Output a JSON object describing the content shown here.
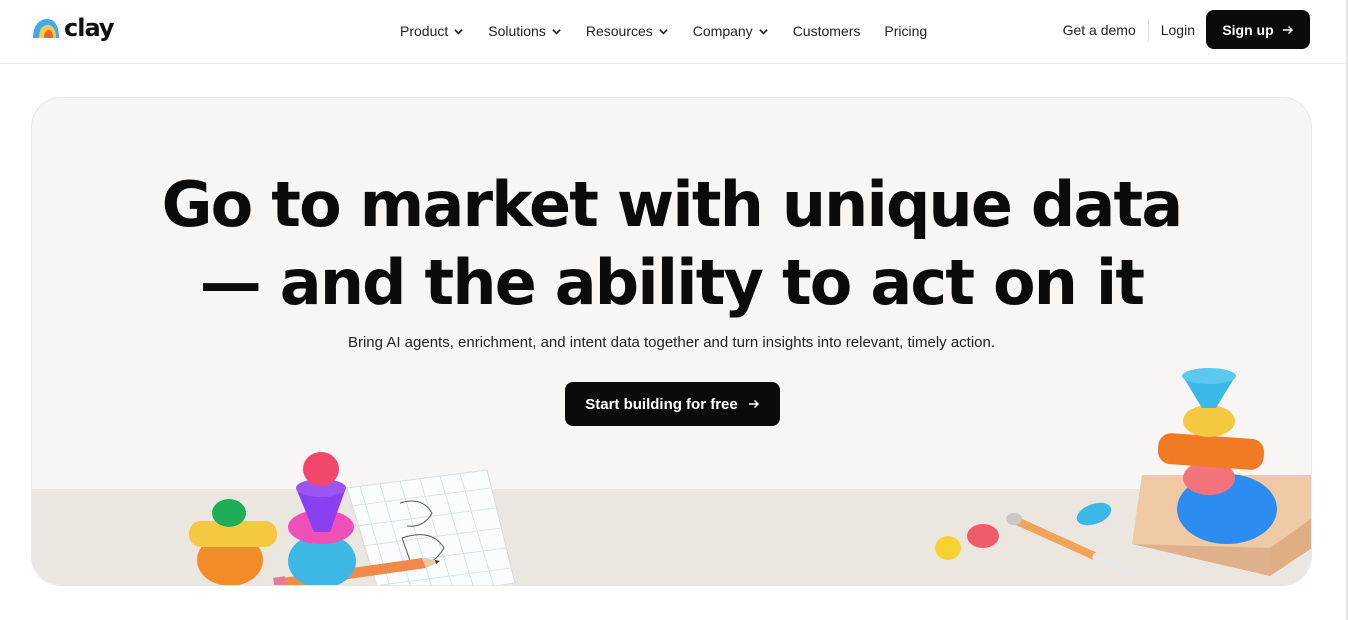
{
  "brand": {
    "name": "clay"
  },
  "nav": {
    "items": [
      {
        "label": "Product",
        "has_dropdown": true
      },
      {
        "label": "Solutions",
        "has_dropdown": true
      },
      {
        "label": "Resources",
        "has_dropdown": true
      },
      {
        "label": "Company",
        "has_dropdown": true
      },
      {
        "label": "Customers",
        "has_dropdown": false
      },
      {
        "label": "Pricing",
        "has_dropdown": false
      }
    ],
    "demo_label": "Get a demo",
    "login_label": "Login",
    "signup_label": "Sign up"
  },
  "hero": {
    "headline_line1": "Go to market with unique data",
    "headline_line2": "— and the ability to act on it",
    "subhead": "Bring AI agents, enrichment, and intent data together and turn insights into relevant, timely action.",
    "cta_label": "Start building for free"
  },
  "colors": {
    "primary": "#0b0b0b",
    "hero_bg": "#f7f6f4",
    "hero_floor": "#ebe7e0"
  },
  "icons": [
    "chevron-down-icon",
    "arrow-right-icon"
  ]
}
